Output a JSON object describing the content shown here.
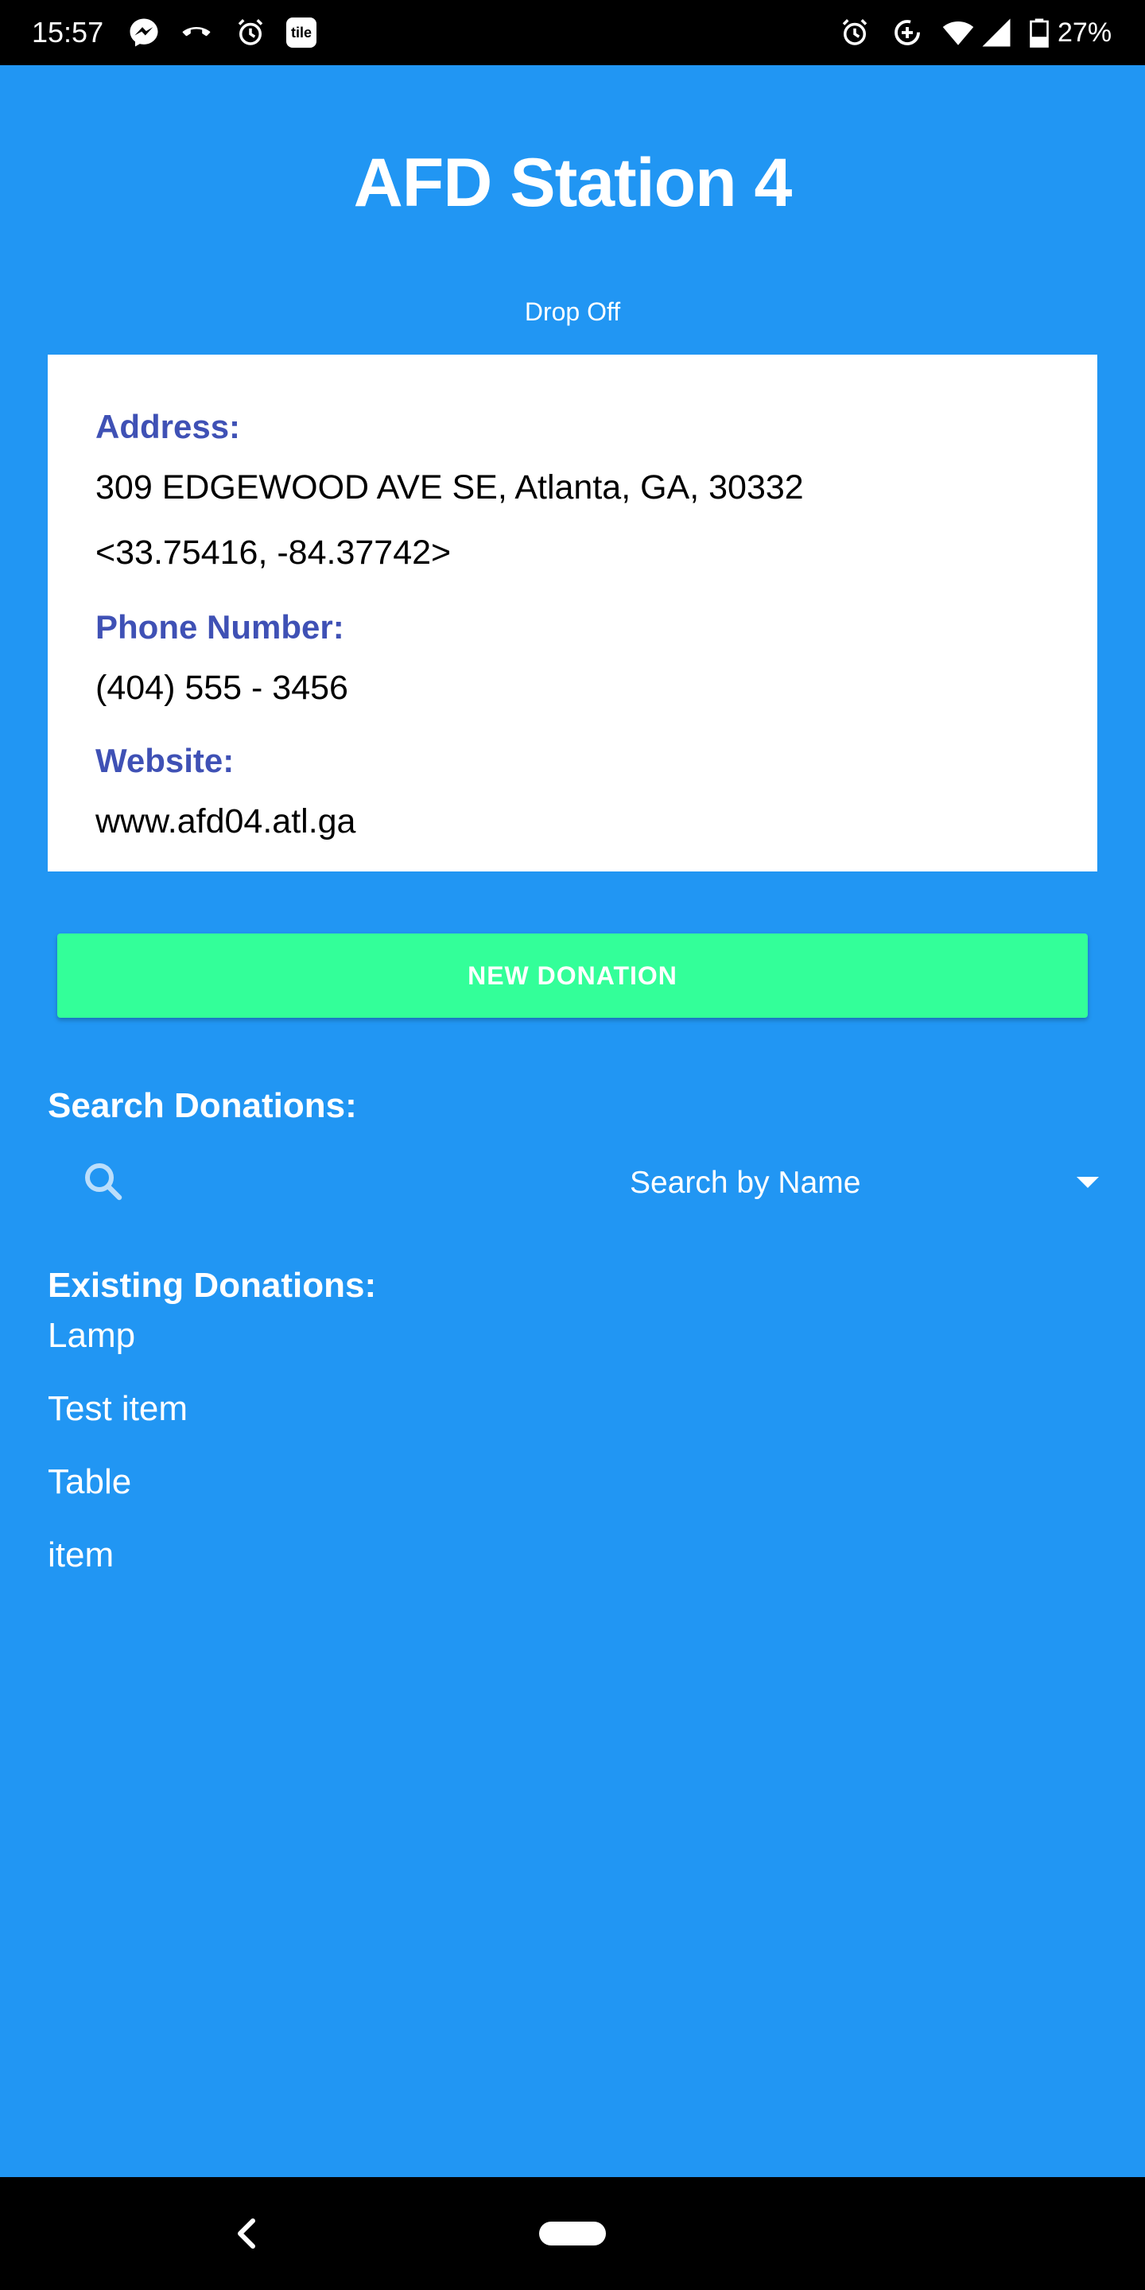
{
  "status_bar": {
    "time": "15:57",
    "battery": "27%",
    "icons_left": [
      "messenger-icon",
      "phone-call-icon",
      "alarm-icon",
      "tile-icon"
    ],
    "icons_right": [
      "alarm-icon",
      "data-saver-icon",
      "wifi-icon",
      "signal-icon",
      "battery-icon"
    ],
    "tile_label": "tile"
  },
  "header": {
    "title": "AFD Station 4",
    "subtitle": "Drop Off"
  },
  "info_card": {
    "address_label": "Address:",
    "address": "309 EDGEWOOD AVE SE, Atlanta, GA, 30332",
    "coordinates": "<33.75416, -84.37742>",
    "phone_label": "Phone Number:",
    "phone": "(404) 555 - 3456",
    "website_label": "Website:",
    "website": "www.afd04.atl.ga"
  },
  "new_donation_button": "NEW DONATION",
  "search": {
    "label": "Search Donations:",
    "mode_selected": "Search by Name"
  },
  "donations": {
    "label": "Existing Donations:",
    "items": [
      "Lamp",
      "Test item",
      "Table",
      "item"
    ]
  },
  "colors": {
    "background": "#2196F3",
    "label_accent": "#3F51B5",
    "button": "#33FF99"
  }
}
